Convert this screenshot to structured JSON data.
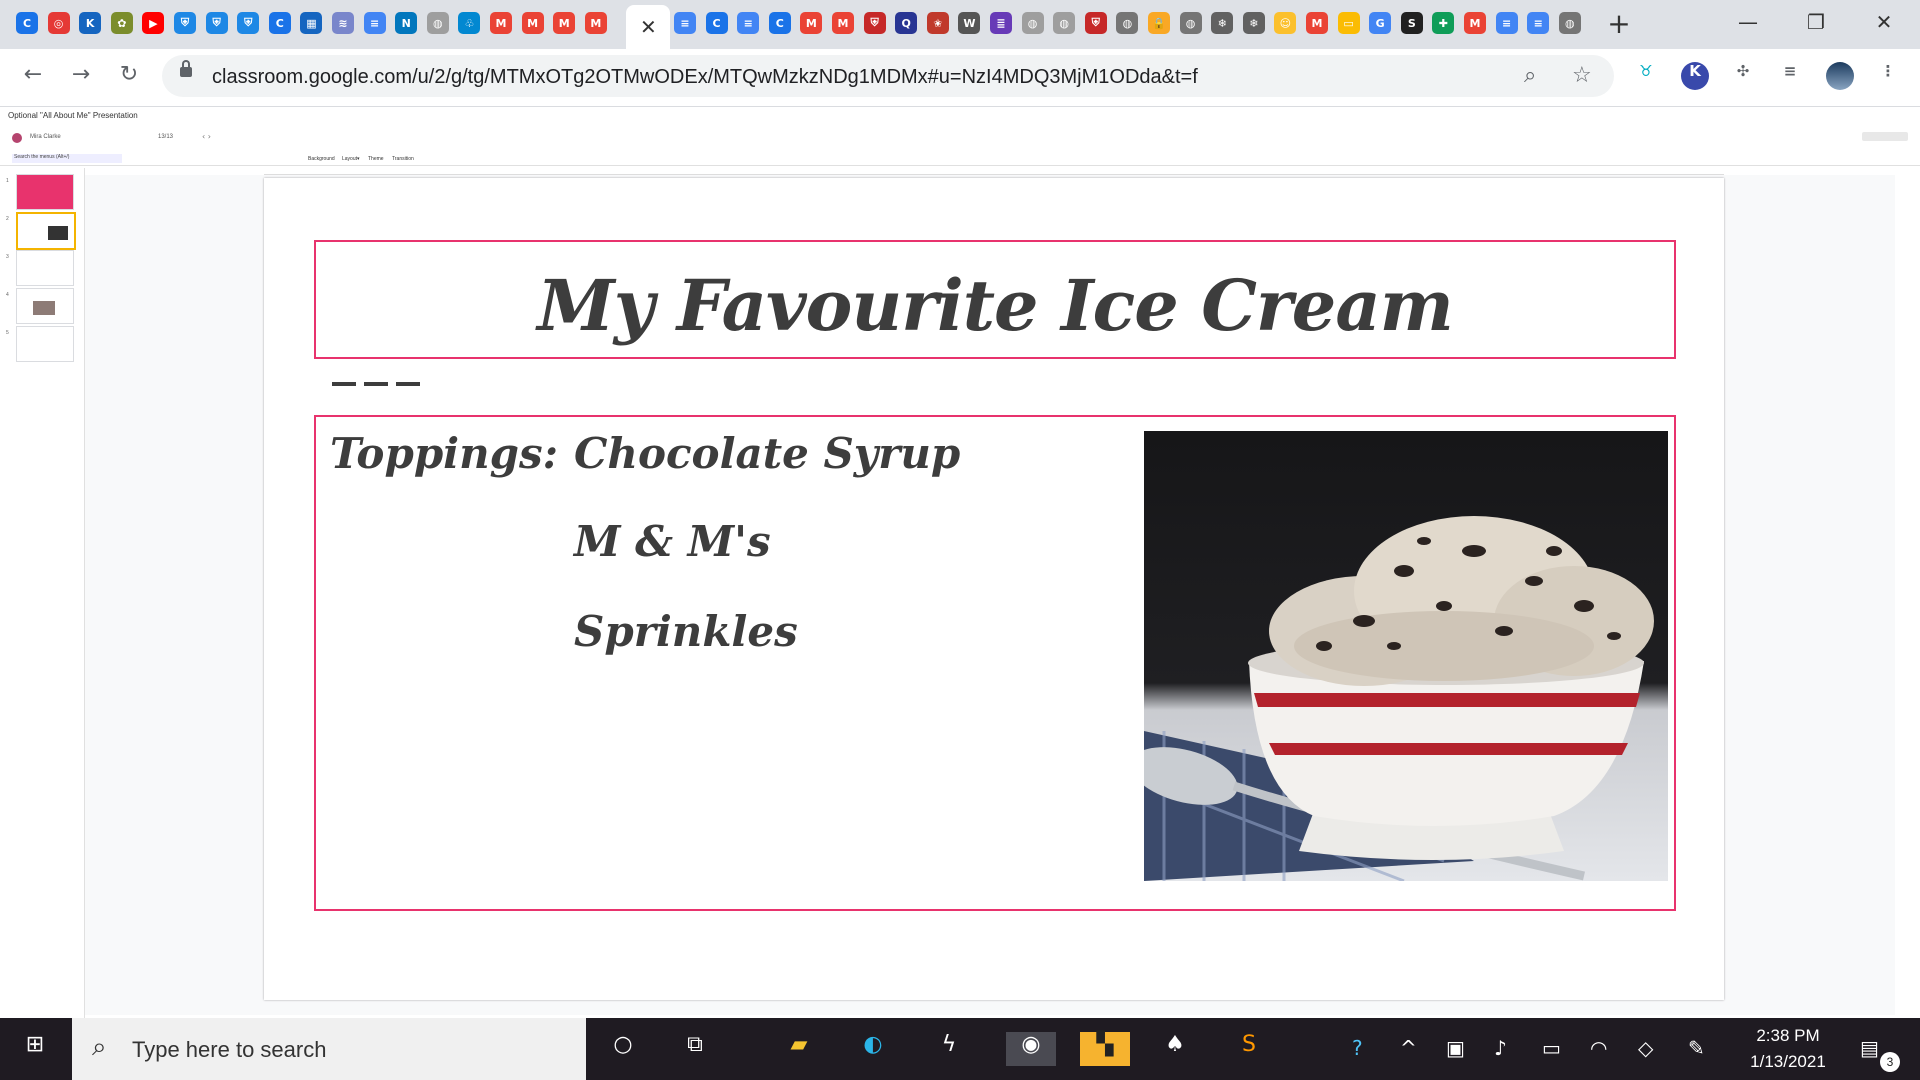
{
  "browser": {
    "tabs": [
      {
        "icon": "chrome-c-icon",
        "glyph": "C",
        "color": "#1a73e8"
      },
      {
        "icon": "red-target-icon",
        "glyph": "◎",
        "color": "#e53935"
      },
      {
        "icon": "k-icon",
        "glyph": "K",
        "color": "#1565c0"
      },
      {
        "icon": "leaf-icon",
        "glyph": "✿",
        "color": "#7b8d2c"
      },
      {
        "icon": "youtube-icon",
        "glyph": "▶",
        "color": "#ff0000"
      },
      {
        "icon": "shield-icon",
        "glyph": "⛨",
        "color": "#1e88e5"
      },
      {
        "icon": "shield-icon",
        "glyph": "⛨",
        "color": "#1e88e5"
      },
      {
        "icon": "shield-icon",
        "glyph": "⛨",
        "color": "#1e88e5"
      },
      {
        "icon": "chrome-c-icon",
        "glyph": "C",
        "color": "#1a73e8"
      },
      {
        "icon": "building-icon",
        "glyph": "▦",
        "color": "#1565c0"
      },
      {
        "icon": "wave-icon",
        "glyph": "≋",
        "color": "#7986cb"
      },
      {
        "icon": "docs-icon",
        "glyph": "≡",
        "color": "#4285f4"
      },
      {
        "icon": "nn-icon",
        "glyph": "N",
        "color": "#0277bd"
      },
      {
        "icon": "globe-icon",
        "glyph": "◍",
        "color": "#9e9e9e"
      },
      {
        "icon": "drop-icon",
        "glyph": "♧",
        "color": "#0288d1"
      },
      {
        "icon": "gmail-icon",
        "glyph": "M",
        "color": "#ea4335"
      },
      {
        "icon": "gmail-icon",
        "glyph": "M",
        "color": "#ea4335"
      },
      {
        "icon": "gmail-icon",
        "glyph": "M",
        "color": "#ea4335"
      },
      {
        "icon": "gmail-icon",
        "glyph": "M",
        "color": "#ea4335"
      }
    ],
    "tabs_right": [
      {
        "icon": "docs-icon",
        "glyph": "≡",
        "color": "#4285f4"
      },
      {
        "icon": "chrome-c-icon",
        "glyph": "C",
        "color": "#1a73e8"
      },
      {
        "icon": "docs-icon",
        "glyph": "≡",
        "color": "#4285f4"
      },
      {
        "icon": "chrome-c-icon",
        "glyph": "C",
        "color": "#1a73e8"
      },
      {
        "icon": "gmail-icon",
        "glyph": "M",
        "color": "#ea4335"
      },
      {
        "icon": "gmail-icon",
        "glyph": "M",
        "color": "#ea4335"
      },
      {
        "icon": "shield-red-icon",
        "glyph": "⛨",
        "color": "#c62828"
      },
      {
        "icon": "q-icon",
        "glyph": "Q",
        "color": "#283593"
      },
      {
        "icon": "star-icon",
        "glyph": "✬",
        "color": "#c0392b"
      },
      {
        "icon": "w-icon",
        "glyph": "W",
        "color": "#555"
      },
      {
        "icon": "form-icon",
        "glyph": "≣",
        "color": "#673ab7"
      },
      {
        "icon": "globe-icon",
        "glyph": "◍",
        "color": "#9e9e9e"
      },
      {
        "icon": "globe-icon",
        "glyph": "◍",
        "color": "#9e9e9e"
      },
      {
        "icon": "shield-red-icon",
        "glyph": "⛨",
        "color": "#c62828"
      },
      {
        "icon": "globe-icon",
        "glyph": "◍",
        "color": "#757575"
      },
      {
        "icon": "lock-icon",
        "glyph": "🔒",
        "color": "#f9a825"
      },
      {
        "icon": "globe-icon",
        "glyph": "◍",
        "color": "#757575"
      },
      {
        "icon": "snowflake-icon",
        "glyph": "❄",
        "color": "#616161"
      },
      {
        "icon": "snowflake-icon",
        "glyph": "❄",
        "color": "#616161"
      },
      {
        "icon": "smiley-icon",
        "glyph": "☺",
        "color": "#fbc02d"
      },
      {
        "icon": "gmail-icon",
        "glyph": "M",
        "color": "#ea4335"
      },
      {
        "icon": "slides-icon",
        "glyph": "▭",
        "color": "#fbbc04"
      },
      {
        "icon": "google-g-icon",
        "glyph": "G",
        "color": "#4285f4"
      },
      {
        "icon": "s-icon",
        "glyph": "S",
        "color": "#212121"
      },
      {
        "icon": "plus-green-icon",
        "glyph": "✚",
        "color": "#0f9d58"
      },
      {
        "icon": "gmail-icon",
        "glyph": "M",
        "color": "#ea4335"
      },
      {
        "icon": "docs-icon",
        "glyph": "≡",
        "color": "#4285f4"
      },
      {
        "icon": "docs-icon",
        "glyph": "≡",
        "color": "#4285f4"
      },
      {
        "icon": "globe-icon",
        "glyph": "◍",
        "color": "#757575"
      }
    ],
    "active_tab_close": "✕",
    "new_tab": "+",
    "window_controls": {
      "minimize": "—",
      "restore": "❐",
      "close": "✕"
    },
    "url": "classroom.google.com/u/2/g/tg/MTMxOTg2OTMwODEx/MTQwMzkzNDg1MDMx#u=NzI4MDQ3MjM1ODda&t=f"
  },
  "slides_app": {
    "doc_title": "Optional \"All About Me\" Presentation",
    "account_name": "Mira Clarke",
    "zoom": "13/13",
    "search_menus": "Search the menus (Alt+/)",
    "toolbar_labels": [
      "Background",
      "Layout▾",
      "Theme",
      "Transition"
    ]
  },
  "filmstrip": [
    {
      "num": "1"
    },
    {
      "num": "2"
    },
    {
      "num": "3"
    },
    {
      "num": "4"
    },
    {
      "num": "5"
    }
  ],
  "slide": {
    "title": "My Favourite Ice Cream",
    "toppings_label": "Toppings:",
    "toppings": [
      "Chocolate Syrup",
      "M & M's",
      "Sprinkles"
    ]
  },
  "taskbar": {
    "search_placeholder": "Type here to search",
    "time": "2:38 PM",
    "date": "1/13/2021",
    "notification_count": "3"
  }
}
